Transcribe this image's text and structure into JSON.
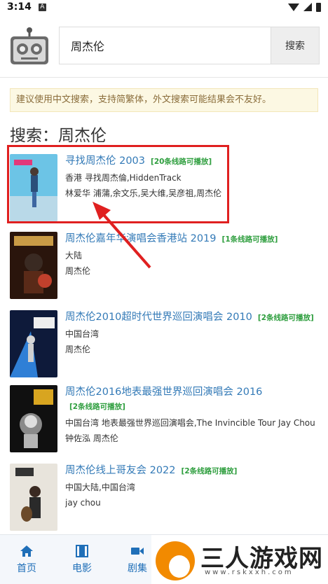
{
  "status_bar": {
    "time": "3:14",
    "notification_icon": "A"
  },
  "search": {
    "value": "周杰伦",
    "button_label": "搜索"
  },
  "notice": "建议使用中文搜索，支持简繁体，外文搜索可能结果会不友好。",
  "result_heading": "搜索：周杰伦",
  "results": [
    {
      "title": "寻找周杰伦 2003",
      "badge": "[20条线路可播放]",
      "meta1": "香港 寻找周杰倫,HiddenTrack",
      "meta2": "林爱华 浦蒲,余文乐,吴大维,吴彦祖,周杰伦"
    },
    {
      "title": "周杰伦嘉年华演唱会香港站 2019",
      "badge": "[1条线路可播放]",
      "meta1": "大陆",
      "meta2": "周杰伦"
    },
    {
      "title": "周杰伦2010超时代世界巡回演唱会 2010",
      "badge": "[2条线路可播放]",
      "meta1": "中国台湾",
      "meta2": "周杰伦"
    },
    {
      "title": "周杰伦2016地表最强世界巡回演唱会 2016",
      "badge": "[2条线路可播放]",
      "meta1": "中国台湾 地表最强世界巡回演唱会,The Invincible Tour Jay Chou",
      "meta2": "钟佐泓 周杰伦"
    },
    {
      "title": "周杰伦线上哥友会 2022",
      "badge": "[2条线路可播放]",
      "meta1": "中国大陆,中国台湾",
      "meta2": "jay chou"
    }
  ],
  "tabs": [
    {
      "label": "首页",
      "icon": "home-icon"
    },
    {
      "label": "电影",
      "icon": "film-icon"
    },
    {
      "label": "剧集",
      "icon": "video-camera-icon"
    }
  ],
  "watermark": {
    "text": "三人游戏网",
    "url": "www.rskxxh.com"
  },
  "colors": {
    "link": "#337ab7",
    "badge": "#2e9e3e",
    "notice_bg": "#fcf8e3",
    "notice_text": "#8a6d3b",
    "highlight": "#e02020",
    "tab": "#1f6fb8"
  }
}
